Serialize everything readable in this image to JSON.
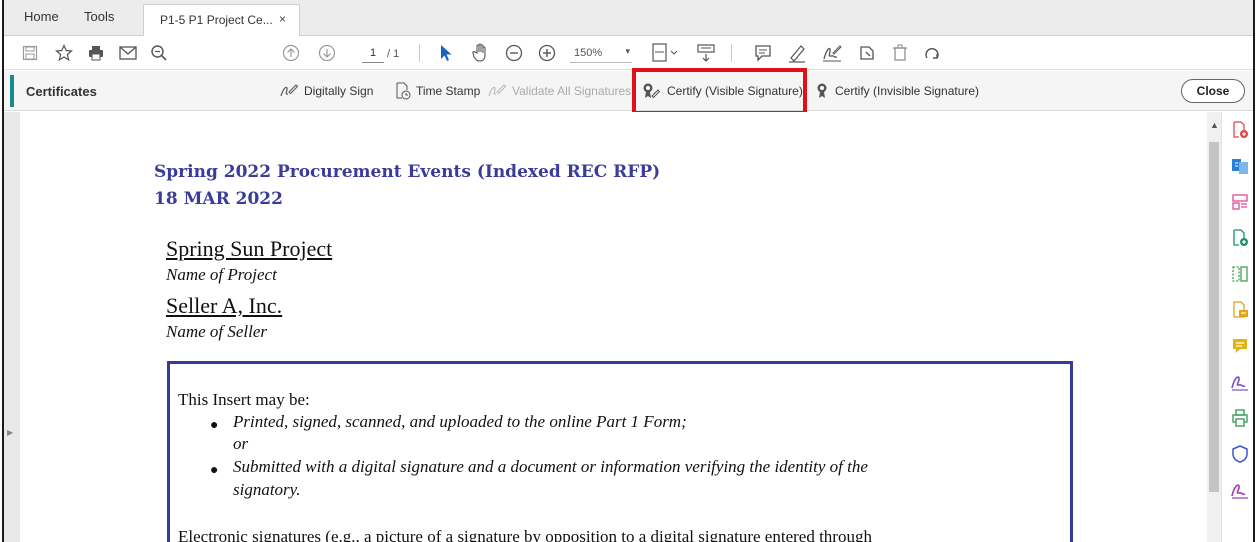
{
  "tabs": {
    "home": "Home",
    "tools": "Tools",
    "document": "P1-5 P1 Project Ce...",
    "close_glyph": "×"
  },
  "toolbar": {
    "page_current": "1",
    "page_total": "/ 1",
    "zoom": "150%"
  },
  "certificates": {
    "title": "Certificates",
    "digitally_sign": "Digitally Sign",
    "time_stamp": "Time Stamp",
    "validate_all": "Validate All Signatures",
    "certify_visible": "Certify (Visible Signature)",
    "certify_invisible": "Certify (Invisible Signature)",
    "close": "Close"
  },
  "document": {
    "heading": "Spring 2022 Procurement Events (Indexed REC RFP)",
    "date": "18 MAR 2022",
    "project_name": "Spring Sun Project",
    "project_caption": "Name of Project",
    "seller_name": "Seller A, Inc.",
    "seller_caption": "Name of Seller",
    "insert_intro": "This Insert may be:",
    "bullet1": "Printed, signed, scanned, and uploaded to the online Part 1 Form;",
    "or": "or",
    "bullet2a": "Submitted with a digital signature and a document or information verifying the identity of the",
    "bullet2b": "signatory.",
    "tail": "Electronic signatures (e.g., a picture of a signature by opposition to a digital signature entered through"
  },
  "colors": {
    "heading": "#3b3c9a",
    "highlight": "#e0101a",
    "accent": "#1a8a8a"
  }
}
